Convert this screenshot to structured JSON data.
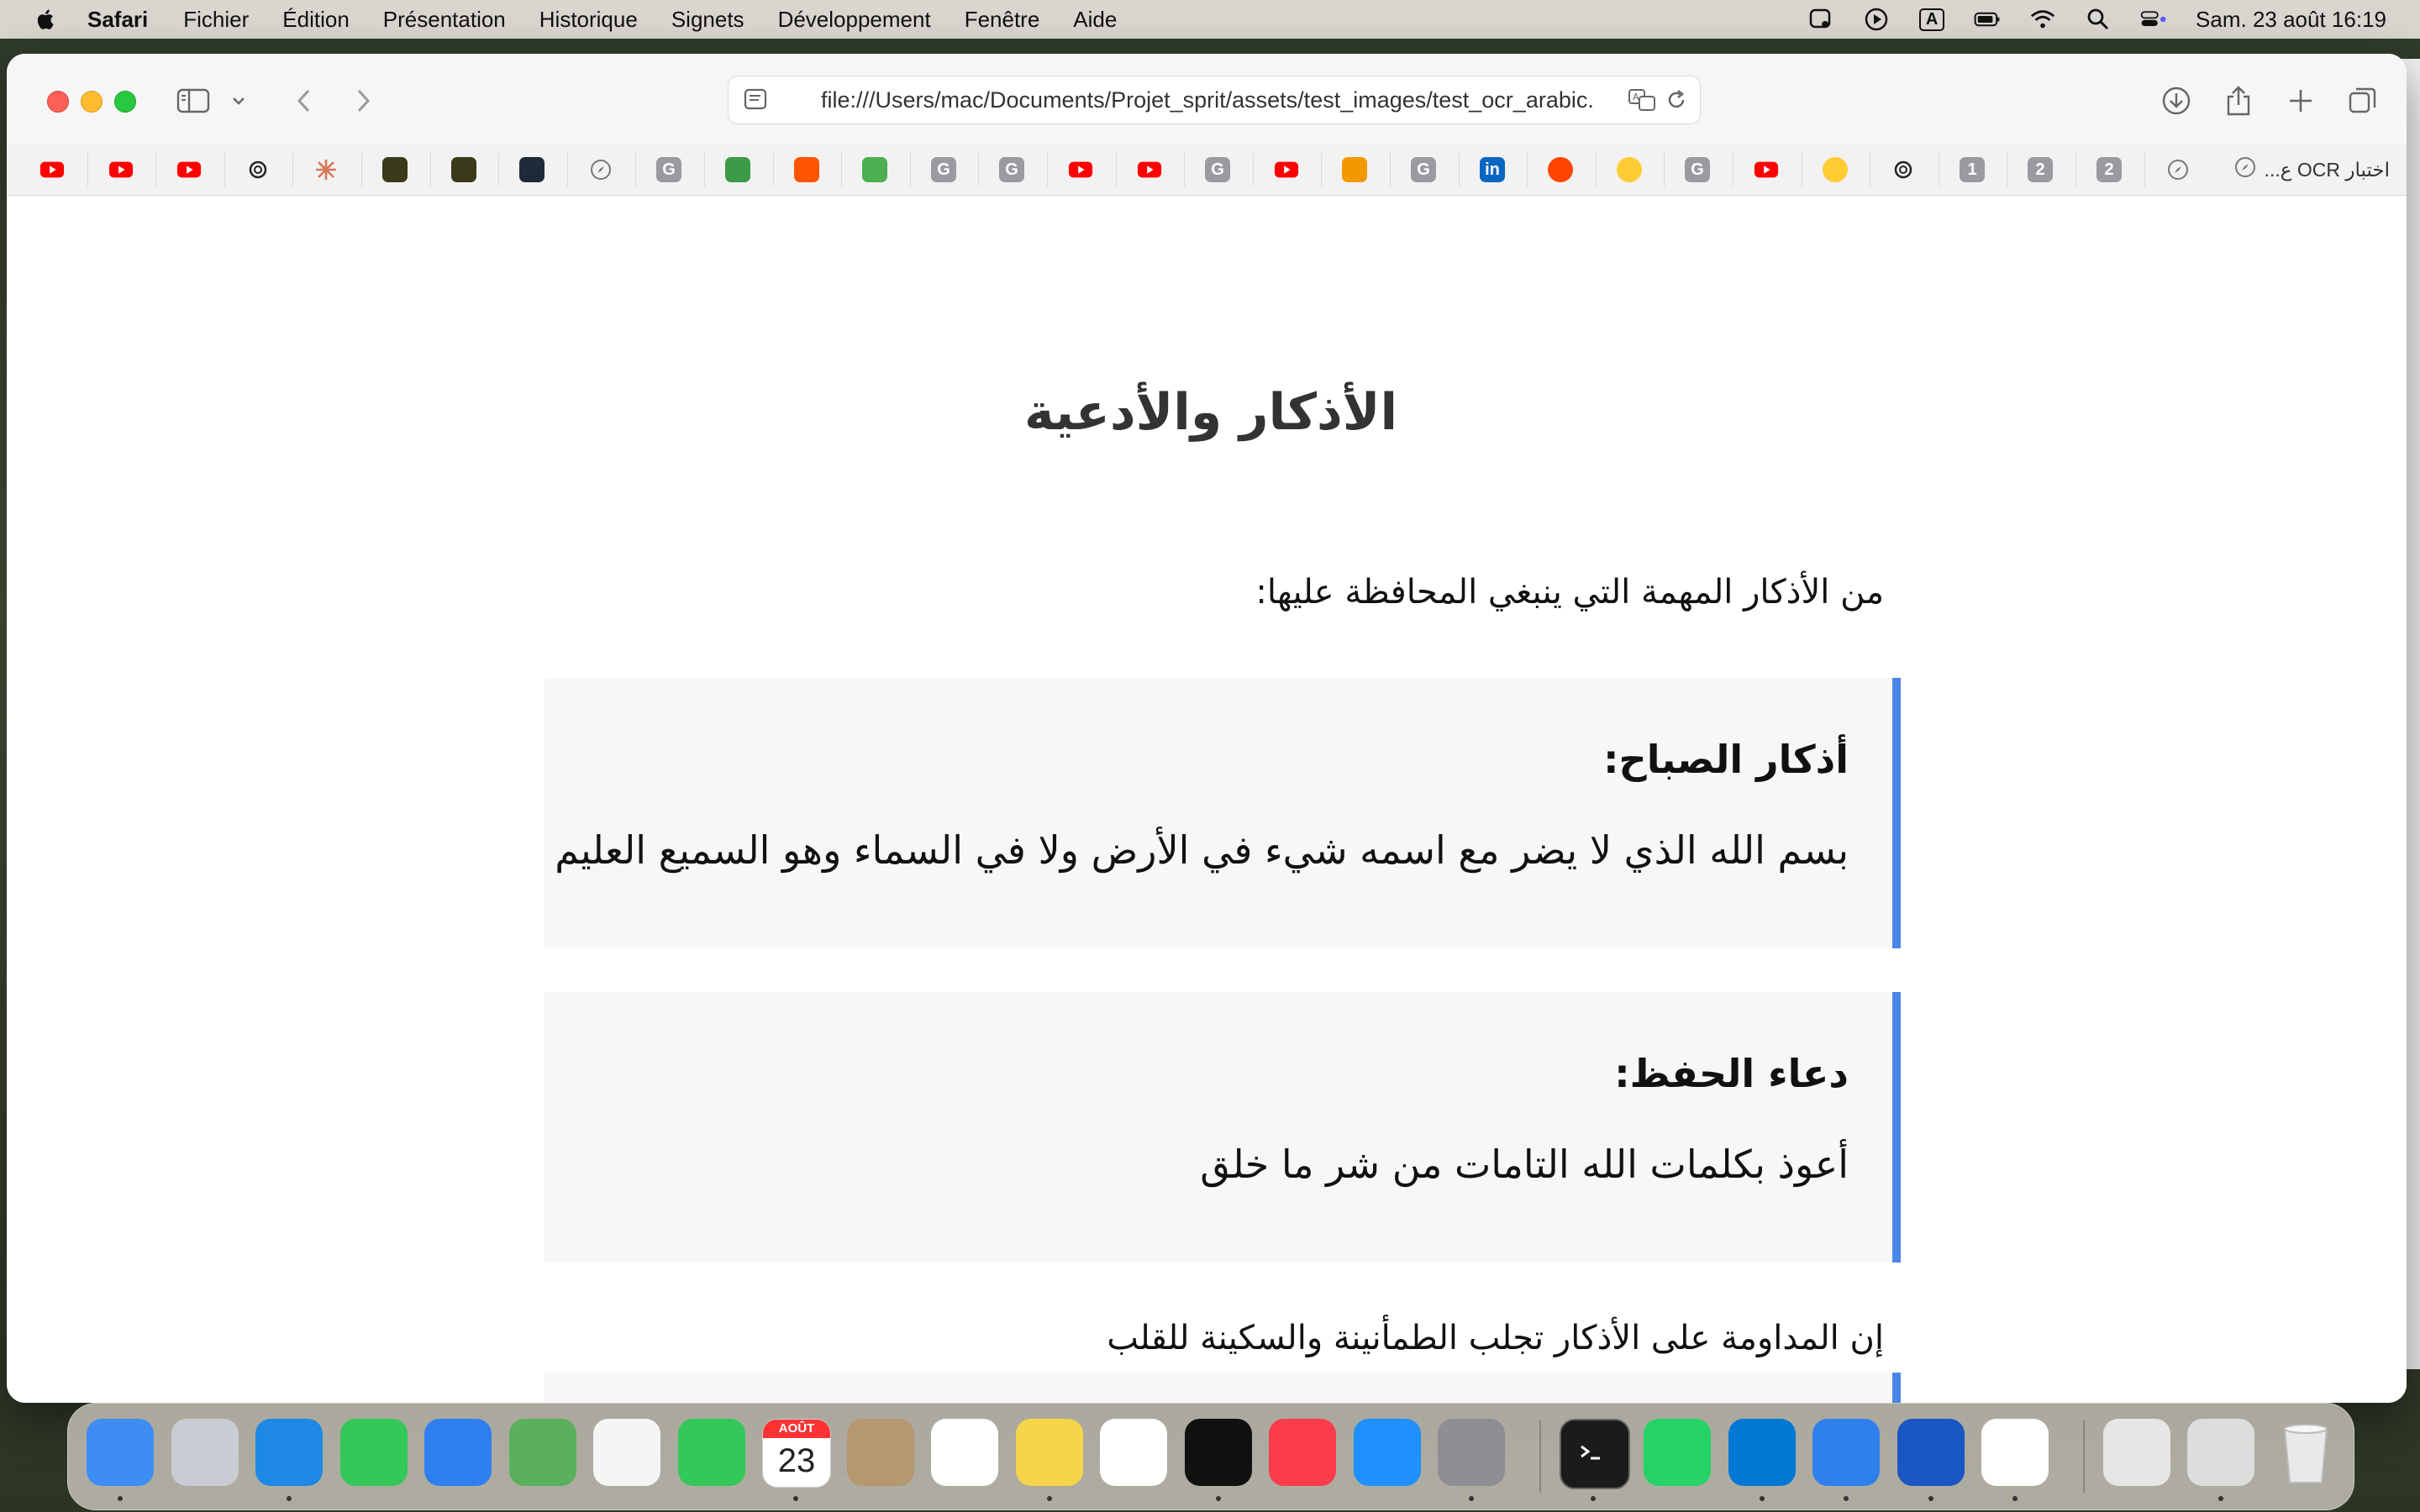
{
  "menubar": {
    "app": "Safari",
    "items": [
      "Fichier",
      "Édition",
      "Présentation",
      "Historique",
      "Signets",
      "Développement",
      "Fenêtre",
      "Aide"
    ],
    "input_indicator": "A",
    "clock": "Sam. 23 août  16:19"
  },
  "browser": {
    "url": "file:///Users/mac/Documents/Projet_sprit/assets/test_images/test_ocr_arabic.",
    "bookmarks": [
      {
        "icon": "youtube-icon",
        "label": "",
        "color": "#ff0000"
      },
      {
        "icon": "youtube-icon",
        "label": "",
        "color": "#ff0000"
      },
      {
        "icon": "youtube-icon",
        "label": "",
        "color": "#ff0000"
      },
      {
        "icon": "openai-icon",
        "label": "",
        "color": "#222222"
      },
      {
        "icon": "claude-icon",
        "label": "",
        "color": "#d97757"
      },
      {
        "icon": "hex-logo-icon",
        "label": "",
        "color": "#3a3a1a"
      },
      {
        "icon": "hex-logo-icon",
        "label": "",
        "color": "#3a3a1a"
      },
      {
        "icon": "badge-logo-icon",
        "label": "",
        "color": "#1e2a3a"
      },
      {
        "icon": "compass-icon",
        "label": "",
        "color": "#888888"
      },
      {
        "icon": "letter-g-icon",
        "label": "G",
        "color": "#9a9aa0"
      },
      {
        "icon": "folder-green-icon",
        "label": "",
        "color": "#3c9b47"
      },
      {
        "icon": "soundcloud-icon",
        "label": "",
        "color": "#ff5500"
      },
      {
        "icon": "play-green-icon",
        "label": "",
        "color": "#4caf50"
      },
      {
        "icon": "letter-g-icon",
        "label": "G",
        "color": "#9a9aa0"
      },
      {
        "icon": "letter-g-icon",
        "label": "G",
        "color": "#9a9aa0"
      },
      {
        "icon": "youtube-icon",
        "label": "",
        "color": "#ff0000"
      },
      {
        "icon": "youtube-icon",
        "label": "",
        "color": "#ff0000"
      },
      {
        "icon": "letter-g-icon",
        "label": "G",
        "color": "#9a9aa0"
      },
      {
        "icon": "youtube-icon",
        "label": "",
        "color": "#ff0000"
      },
      {
        "icon": "infinity-icon",
        "label": "",
        "color": "#f29900"
      },
      {
        "icon": "letter-g-icon",
        "label": "G",
        "color": "#9a9aa0"
      },
      {
        "icon": "linkedin-icon",
        "label": "in",
        "color": "#0a66c2"
      },
      {
        "icon": "reddit-icon",
        "label": "",
        "color": "#ff4500"
      },
      {
        "icon": "huggingface-icon",
        "label": "",
        "color": "#ffcc33"
      },
      {
        "icon": "letter-g-icon",
        "label": "G",
        "color": "#9a9aa0"
      },
      {
        "icon": "youtube-icon",
        "label": "",
        "color": "#ff0000"
      },
      {
        "icon": "huggingface-icon",
        "label": "",
        "color": "#ffcc33"
      },
      {
        "icon": "openai-icon",
        "label": "",
        "color": "#222222"
      },
      {
        "icon": "number-badge-icon",
        "label": "1",
        "color": "#9a9aa0"
      },
      {
        "icon": "number-badge-icon",
        "label": "2",
        "color": "#9a9aa0"
      },
      {
        "icon": "number-badge-icon",
        "label": "2",
        "color": "#9a9aa0"
      },
      {
        "icon": "compass-icon",
        "label": "",
        "color": "#888888"
      }
    ],
    "last_bookmark_label": "اختبار OCR ع..."
  },
  "page": {
    "title": "الأذكار والأدعية",
    "intro": "من الأذكار المهمة التي ينبغي المحافظة عليها:",
    "cards": [
      {
        "title": "أذكار الصباح:",
        "body": "بسم الله الذي لا يضر مع اسمه شيء في الأرض ولا في السماء وهو السميع العليم"
      },
      {
        "title": "دعاء الحفظ:",
        "body": "أعوذ بكلمات الله التامات من شر ما خلق"
      }
    ],
    "outro": "إن المداومة على الأذكار تجلب الطمأنينة والسكينة للقلب",
    "accent_color": "#4a86e8"
  },
  "dock": {
    "calendar_month": "AOÛT",
    "calendar_day": "23",
    "apps": [
      {
        "name": "finder",
        "color": "#3d8df5"
      },
      {
        "name": "launchpad",
        "color": "#c9ccd3"
      },
      {
        "name": "safari",
        "color": "#1e88e5"
      },
      {
        "name": "messages",
        "color": "#34c759"
      },
      {
        "name": "mail",
        "color": "#2f7ff0"
      },
      {
        "name": "maps",
        "color": "#5ab05b"
      },
      {
        "name": "photos",
        "color": "#f5f5f5"
      },
      {
        "name": "facetime",
        "color": "#34c759"
      },
      {
        "name": "calendar",
        "color": "#ffffff"
      },
      {
        "name": "contacts",
        "color": "#b59770"
      },
      {
        "name": "reminders",
        "color": "#ffffff"
      },
      {
        "name": "notes",
        "color": "#f7d54a"
      },
      {
        "name": "freeform",
        "color": "#ffffff"
      },
      {
        "name": "apple-tv",
        "color": "#111111"
      },
      {
        "name": "music",
        "color": "#fa3c4c"
      },
      {
        "name": "app-store",
        "color": "#1e90ff"
      },
      {
        "name": "system-settings",
        "color": "#8e8e93"
      },
      {
        "name": "terminal",
        "color": "#1b1b1b"
      },
      {
        "name": "whatsapp",
        "color": "#25d366"
      },
      {
        "name": "vscode",
        "color": "#0078d4"
      },
      {
        "name": "xcode",
        "color": "#2f80ed"
      },
      {
        "name": "audacity",
        "color": "#1a56c4"
      },
      {
        "name": "chrome",
        "color": "#ffffff"
      },
      {
        "name": "music-file",
        "color": "#e6e6e6"
      },
      {
        "name": "screenshot-preview",
        "color": "#dddddd"
      },
      {
        "name": "trash",
        "color": "#e2e2e2"
      }
    ]
  }
}
